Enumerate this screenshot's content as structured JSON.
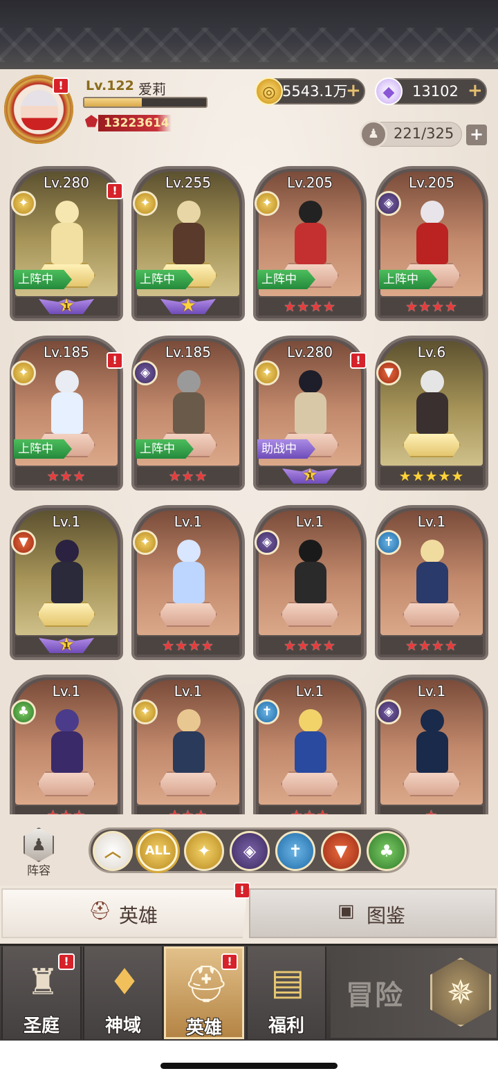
{
  "player": {
    "level": "Lv.122",
    "name": "爱莉",
    "exp_fraction": 0.47,
    "power": "13223614"
  },
  "resources": {
    "gold": "5543.1万",
    "gems": "13102",
    "hero_capacity": "221/325"
  },
  "heroes": [
    {
      "level": "Lv.280",
      "class": "holy",
      "status": "上阵中",
      "stars": "",
      "wing_num": "1",
      "alert": "!",
      "gold": true
    },
    {
      "level": "Lv.255",
      "class": "holy",
      "status": "上阵中",
      "stars": "",
      "wing_num": "★",
      "alert": "",
      "gold": true
    },
    {
      "level": "Lv.205",
      "class": "holy",
      "status": "上阵中",
      "stars": "★★★★",
      "alert": "",
      "gold": false
    },
    {
      "level": "Lv.205",
      "class": "dark",
      "status": "上阵中",
      "stars": "★★★★",
      "alert": "",
      "gold": false
    },
    {
      "level": "Lv.185",
      "class": "holy",
      "status": "上阵中",
      "stars": "★★★",
      "alert": "!",
      "gold": false
    },
    {
      "level": "Lv.185",
      "class": "dark",
      "status": "上阵中",
      "stars": "★★★",
      "alert": "",
      "gold": false
    },
    {
      "level": "Lv.280",
      "class": "holy",
      "status": "助战中",
      "stars": "",
      "wing_num": "1",
      "alert": "!",
      "gold": false
    },
    {
      "level": "Lv.6",
      "class": "beast",
      "status": "",
      "stars": "★★★★★",
      "star_color": "gold",
      "alert": "",
      "gold": true
    },
    {
      "level": "Lv.1",
      "class": "beast",
      "status": "",
      "stars": "",
      "wing_num": "1",
      "alert": "",
      "gold": true
    },
    {
      "level": "Lv.1",
      "class": "holy",
      "status": "",
      "stars": "★★★★",
      "alert": "",
      "gold": false
    },
    {
      "level": "Lv.1",
      "class": "dark",
      "status": "",
      "stars": "★★★★",
      "alert": "",
      "gold": false
    },
    {
      "level": "Lv.1",
      "class": "knight",
      "status": "",
      "stars": "★★★★",
      "alert": "",
      "gold": false
    },
    {
      "level": "Lv.1",
      "class": "nature",
      "status": "",
      "stars": "★★★",
      "alert": "",
      "gold": false
    },
    {
      "level": "Lv.1",
      "class": "holy",
      "status": "",
      "stars": "★★★",
      "alert": "",
      "gold": false
    },
    {
      "level": "Lv.1",
      "class": "knight",
      "status": "",
      "stars": "★★★",
      "alert": "",
      "gold": false
    },
    {
      "level": "Lv.1",
      "class": "dark",
      "status": "",
      "stars": "★",
      "alert": "",
      "gold": false
    }
  ],
  "filter": {
    "lineup_label": "阵容",
    "all_label": "ALL",
    "selected": "ALL"
  },
  "tabs": {
    "hero": "英雄",
    "codex": "图鉴",
    "alert": "!"
  },
  "nav": {
    "items": [
      {
        "label": "圣庭",
        "icon": "castle-icon",
        "alert": "!"
      },
      {
        "label": "神域",
        "icon": "crystal-altar-icon",
        "alert": ""
      },
      {
        "label": "英雄",
        "icon": "helmet-icon",
        "alert": "!"
      },
      {
        "label": "福利",
        "icon": "treasure-chest-icon",
        "alert": ""
      }
    ],
    "adventure": "冒险"
  },
  "colors": {
    "red_alert": "#d6222a",
    "deployed": "#2f9e48",
    "assist": "#8a66cc"
  }
}
